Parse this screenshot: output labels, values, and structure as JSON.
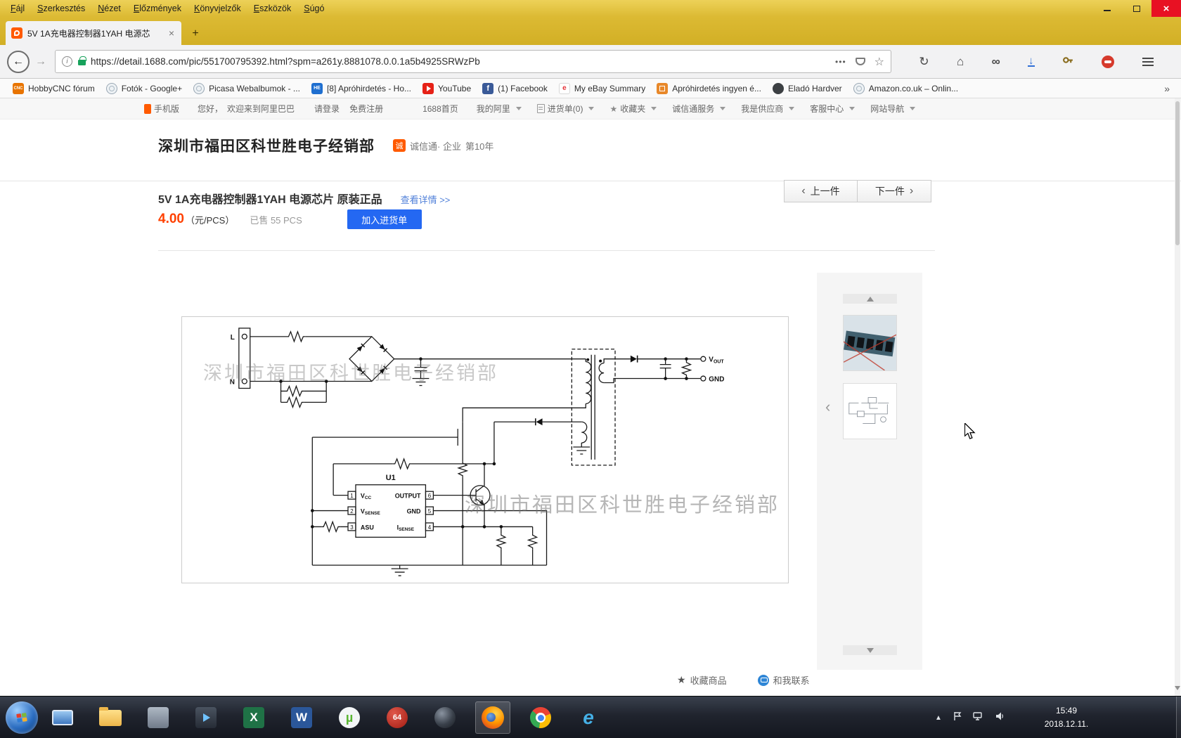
{
  "browser": {
    "menu": [
      "Fájl",
      "Szerkesztés",
      "Nézet",
      "Előzmények",
      "Könyvjelzők",
      "Eszközök",
      "Súgó"
    ],
    "window_controls": {
      "close": "×"
    },
    "tab": {
      "title": "5V 1A充电器控制器1YAH 电源芯",
      "close": "×",
      "new_tab": "+"
    },
    "nav": {
      "back": "←",
      "forward": "→",
      "info": "i",
      "url": "https://detail.1688.com/pic/551700795392.html?spm=a261y.8881078.0.0.1a5b4925SRWzPb",
      "page_actions": "•••",
      "bookmark_star": "☆",
      "reload": "↻",
      "home": "⌂",
      "mask_ext": "∞",
      "download": "↓"
    },
    "bookmarks": {
      "items": [
        {
          "label": "HobbyCNC fórum",
          "icon_text": "CNC"
        },
        {
          "label": "Fotók - Google+",
          "icon_text": ""
        },
        {
          "label": "Picasa Webalbumok - ...",
          "icon_text": ""
        },
        {
          "label": "[8] Apróhirdetés - Ho...",
          "icon_text": "HE"
        },
        {
          "label": "YouTube",
          "icon_text": ""
        },
        {
          "label": "(1) Facebook",
          "icon_text": "f"
        },
        {
          "label": "My eBay Summary",
          "icon_text": "e"
        },
        {
          "label": "Apróhirdetés ingyen é...",
          "icon_text": ""
        },
        {
          "label": "Eladó Hardver",
          "icon_text": ""
        },
        {
          "label": "Amazon.co.uk – Onlin...",
          "icon_text": ""
        }
      ],
      "overflow": "»"
    }
  },
  "site": {
    "topbar": {
      "mobile": "手机版",
      "greeting": "您好，",
      "welcome": "欢迎来到阿里巴巴",
      "login": "请登录",
      "register": "免费注册",
      "home": "1688首页",
      "my_ali": "我的阿里",
      "cart": "进货单(0)",
      "star": "★",
      "favorites": "收藏夹",
      "cxt_service": "诚信通服务",
      "supplier": "我是供应商",
      "service": "客服中心",
      "sitemap": "网站导航"
    },
    "seller": {
      "name": "深圳市福田区科世胜电子经销部",
      "badge_icon": "诚",
      "badge": "诚信通· 企业",
      "years": "第10年"
    },
    "product": {
      "title": "5V 1A充电器控制器1YAH 电源芯片 原装正品",
      "detail_link": "查看详情 >>",
      "price": "4.00",
      "price_unit": "（元/PCS）",
      "sold": "已售 55 PCS",
      "add_to_cart": "加入进货单",
      "prev_arrow": "‹",
      "prev": "上一件",
      "next": "下一件",
      "next_arrow": "›"
    },
    "gallery": {
      "prev": "‹"
    },
    "actions": {
      "star": "★",
      "favorite": "收藏商品",
      "contact": "和我联系"
    },
    "watermark": "深圳市福田区科世胜电子经销部"
  },
  "schematic": {
    "l": "L",
    "n": "N",
    "u1": "U1",
    "vcc_main": "V",
    "vcc_sub": "CC",
    "vsense_main": "V",
    "vsense_sub": "SENSE",
    "asu": "ASU",
    "output": "OUTPUT",
    "gnd": "GND",
    "isense_main": "I",
    "isense_sub": "SENSE",
    "vout_main": "V",
    "vout_sub": "OUT",
    "gnd_out": "GND",
    "pin1": "1",
    "pin2": "2",
    "pin3": "3",
    "pin4": "4",
    "pin5": "5",
    "pin6": "6"
  },
  "taskbar": {
    "time": "15:49",
    "date": "2018.12.11.",
    "icons": {
      "excel": "X",
      "word": "W",
      "utorrent": "µ",
      "badge64": "64",
      "ie": "e"
    },
    "tray_expand": "▲"
  }
}
